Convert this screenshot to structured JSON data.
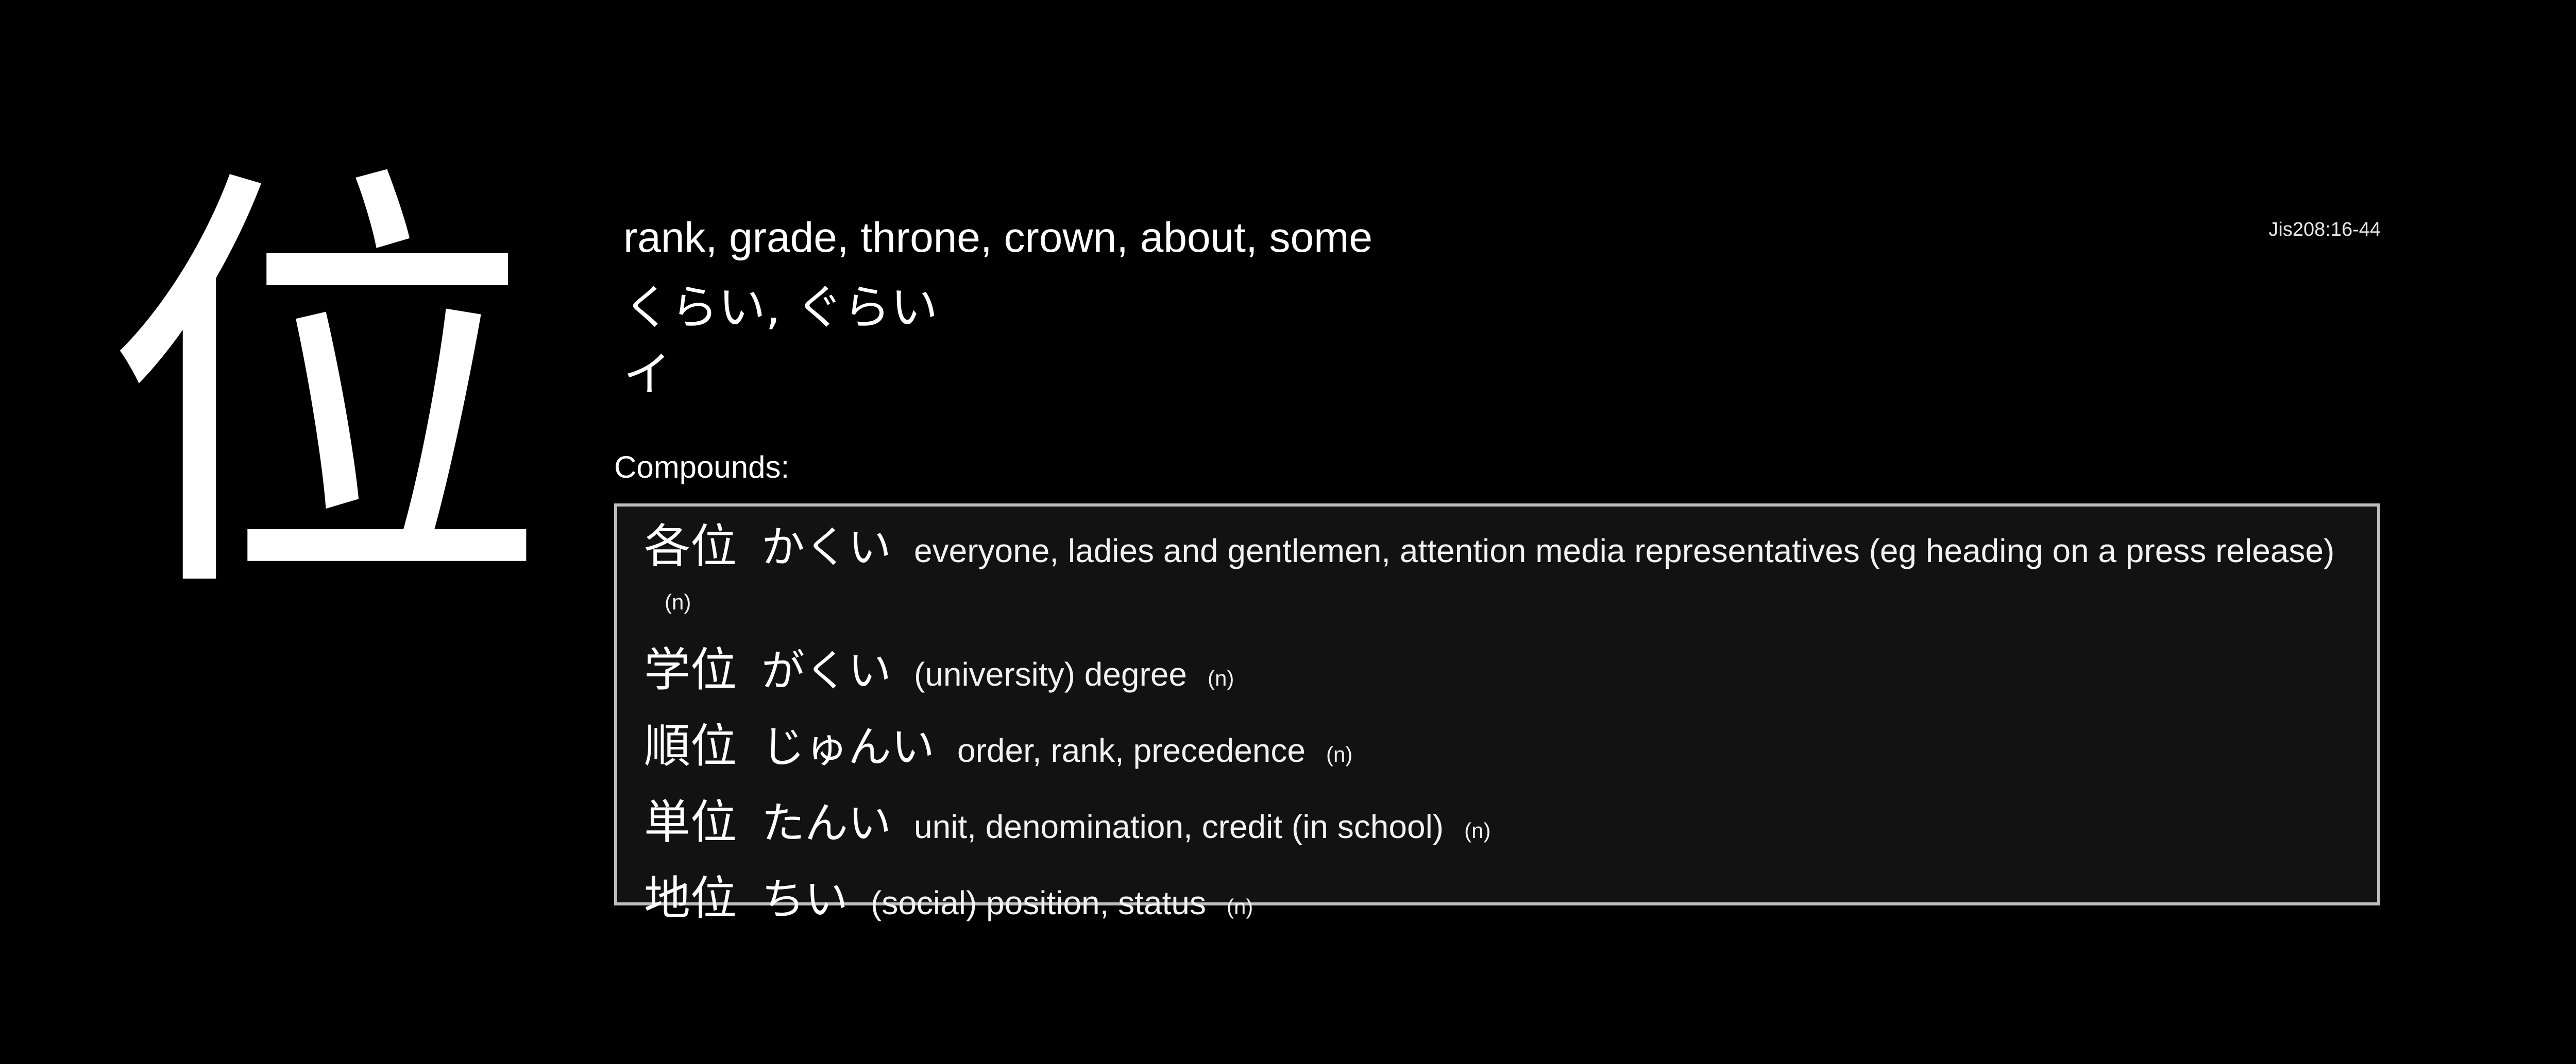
{
  "kanji": "位",
  "jis_code": "Jis208:16-44",
  "meanings": "rank, grade, throne, crown, about, some",
  "kun_readings": "くらい, ぐらい",
  "on_readings": "イ",
  "compounds_label": "Compounds:",
  "compounds": [
    {
      "word": "各位",
      "reading": "かくい",
      "gloss": "everyone, ladies and gentlemen, attention media representatives (eg heading on a press release)",
      "pos": "(n)"
    },
    {
      "word": "学位",
      "reading": "がくい",
      "gloss": "(university) degree",
      "pos": "(n)"
    },
    {
      "word": "順位",
      "reading": "じゅんい",
      "gloss": "order, rank, precedence",
      "pos": "(n)"
    },
    {
      "word": "単位",
      "reading": "たんい",
      "gloss": "unit, denomination, credit (in school)",
      "pos": "(n)"
    },
    {
      "word": "地位",
      "reading": "ちい",
      "gloss": "(social) position, status",
      "pos": "(n)"
    }
  ]
}
